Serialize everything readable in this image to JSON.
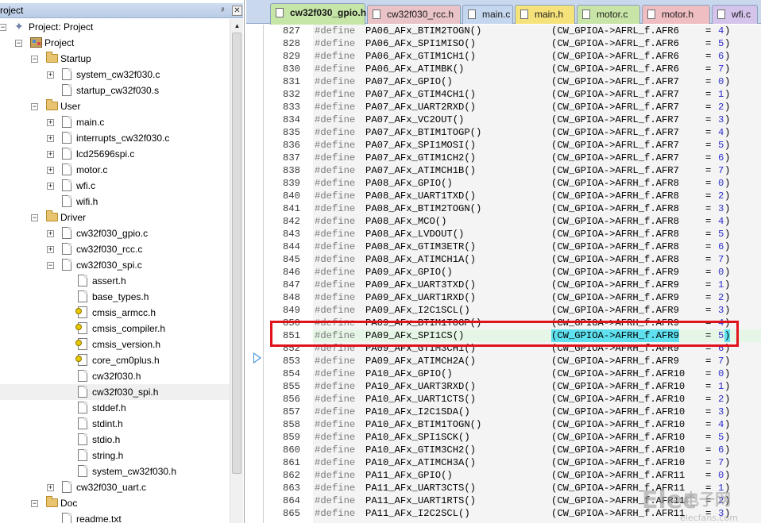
{
  "project_pane": {
    "title": "roject",
    "pin_glyph": "ᵖ",
    "close_glyph": "✕",
    "scroll_up_glyph": "▲",
    "tree": [
      {
        "label": "Project: Project",
        "depth": 0,
        "icon": "root-project-icon",
        "expander": "−"
      },
      {
        "label": "Project",
        "depth": 1,
        "icon": "target-icon",
        "expander": "−"
      },
      {
        "label": "Startup",
        "depth": 2,
        "icon": "folder-icon",
        "expander": "−"
      },
      {
        "label": "system_cw32f030.c",
        "depth": 3,
        "icon": "file-icon",
        "expander": "+"
      },
      {
        "label": "startup_cw32f030.s",
        "depth": 3,
        "icon": "file-icon",
        "expander": ""
      },
      {
        "label": "User",
        "depth": 2,
        "icon": "folder-icon",
        "expander": "−"
      },
      {
        "label": "main.c",
        "depth": 3,
        "icon": "file-icon",
        "expander": "+"
      },
      {
        "label": "interrupts_cw32f030.c",
        "depth": 3,
        "icon": "file-icon",
        "expander": "+"
      },
      {
        "label": "lcd25696spi.c",
        "depth": 3,
        "icon": "file-icon",
        "expander": "+"
      },
      {
        "label": "motor.c",
        "depth": 3,
        "icon": "file-icon",
        "expander": "+"
      },
      {
        "label": "wfi.c",
        "depth": 3,
        "icon": "file-icon",
        "expander": "+"
      },
      {
        "label": "wifi.h",
        "depth": 3,
        "icon": "file-icon",
        "expander": ""
      },
      {
        "label": "Driver",
        "depth": 2,
        "icon": "folder-icon",
        "expander": "−"
      },
      {
        "label": "cw32f030_gpio.c",
        "depth": 3,
        "icon": "file-icon",
        "expander": "+"
      },
      {
        "label": "cw32f030_rcc.c",
        "depth": 3,
        "icon": "file-icon",
        "expander": "+"
      },
      {
        "label": "cw32f030_spi.c",
        "depth": 3,
        "icon": "file-icon",
        "expander": "−"
      },
      {
        "label": "assert.h",
        "depth": 4,
        "icon": "file-icon",
        "expander": ""
      },
      {
        "label": "base_types.h",
        "depth": 4,
        "icon": "file-icon",
        "expander": ""
      },
      {
        "label": "cmsis_armcc.h",
        "depth": 4,
        "icon": "key-file-icon",
        "expander": ""
      },
      {
        "label": "cmsis_compiler.h",
        "depth": 4,
        "icon": "key-file-icon",
        "expander": ""
      },
      {
        "label": "cmsis_version.h",
        "depth": 4,
        "icon": "key-file-icon",
        "expander": ""
      },
      {
        "label": "core_cm0plus.h",
        "depth": 4,
        "icon": "key-file-icon",
        "expander": ""
      },
      {
        "label": "cw32f030.h",
        "depth": 4,
        "icon": "file-icon",
        "expander": ""
      },
      {
        "label": "cw32f030_spi.h",
        "depth": 4,
        "icon": "file-icon",
        "expander": "",
        "selected": true
      },
      {
        "label": "stddef.h",
        "depth": 4,
        "icon": "file-icon",
        "expander": ""
      },
      {
        "label": "stdint.h",
        "depth": 4,
        "icon": "file-icon",
        "expander": ""
      },
      {
        "label": "stdio.h",
        "depth": 4,
        "icon": "file-icon",
        "expander": ""
      },
      {
        "label": "string.h",
        "depth": 4,
        "icon": "file-icon",
        "expander": ""
      },
      {
        "label": "system_cw32f030.h",
        "depth": 4,
        "icon": "file-icon",
        "expander": ""
      },
      {
        "label": "cw32f030_uart.c",
        "depth": 3,
        "icon": "file-icon",
        "expander": "+"
      },
      {
        "label": "Doc",
        "depth": 2,
        "icon": "folder-icon",
        "expander": "−"
      },
      {
        "label": "readme.txt",
        "depth": 3,
        "icon": "file-icon",
        "expander": ""
      }
    ]
  },
  "tabs": [
    {
      "label": "cw32f030_gpio.h",
      "color": "#c6e6a8",
      "active": true
    },
    {
      "label": "cw32f030_rcc.h",
      "color": "#e9c3c6",
      "active": false
    },
    {
      "label": "main.c",
      "color": "#c5d7ef",
      "active": false
    },
    {
      "label": "main.h",
      "color": "#f5e27a",
      "active": false
    },
    {
      "label": "motor.c",
      "color": "#c8e4a6",
      "active": false
    },
    {
      "label": "motor.h",
      "color": "#efbec3",
      "active": false
    },
    {
      "label": "wfi.c",
      "color": "#d4c4ec",
      "active": false
    }
  ],
  "code": {
    "current_line": 851,
    "lines": [
      {
        "n": "827",
        "kw": "#define",
        "name": "PA06_AFx_BTIM2TOGN()",
        "expr": "(CW_GPIOA->AFRL_f.AFR6",
        "val": "4"
      },
      {
        "n": "828",
        "kw": "#define",
        "name": "PA06_AFx_SPI1MISO()",
        "expr": "(CW_GPIOA->AFRL_f.AFR6",
        "val": "5"
      },
      {
        "n": "829",
        "kw": "#define",
        "name": "PA06_AFx_GTIM1CH1()",
        "expr": "(CW_GPIOA->AFRL_f.AFR6",
        "val": "6"
      },
      {
        "n": "830",
        "kw": "#define",
        "name": "PA06_AFx_ATIMBK()",
        "expr": "(CW_GPIOA->AFRL_f.AFR6",
        "val": "7"
      },
      {
        "n": "831",
        "kw": "#define",
        "name": "PA07_AFx_GPIO()",
        "expr": "(CW_GPIOA->AFRL_f.AFR7",
        "val": "0"
      },
      {
        "n": "832",
        "kw": "#define",
        "name": "PA07_AFx_GTIM4CH1()",
        "expr": "(CW_GPIOA->AFRL_f.AFR7",
        "val": "1"
      },
      {
        "n": "833",
        "kw": "#define",
        "name": "PA07_AFx_UART2RXD()",
        "expr": "(CW_GPIOA->AFRL_f.AFR7",
        "val": "2"
      },
      {
        "n": "834",
        "kw": "#define",
        "name": "PA07_AFx_VC2OUT()",
        "expr": "(CW_GPIOA->AFRL_f.AFR7",
        "val": "3"
      },
      {
        "n": "835",
        "kw": "#define",
        "name": "PA07_AFx_BTIM1TOGP()",
        "expr": "(CW_GPIOA->AFRL_f.AFR7",
        "val": "4"
      },
      {
        "n": "836",
        "kw": "#define",
        "name": "PA07_AFx_SPI1MOSI()",
        "expr": "(CW_GPIOA->AFRL_f.AFR7",
        "val": "5"
      },
      {
        "n": "837",
        "kw": "#define",
        "name": "PA07_AFx_GTIM1CH2()",
        "expr": "(CW_GPIOA->AFRL_f.AFR7",
        "val": "6"
      },
      {
        "n": "838",
        "kw": "#define",
        "name": "PA07_AFx_ATIMCH1B()",
        "expr": "(CW_GPIOA->AFRL_f.AFR7",
        "val": "7"
      },
      {
        "n": "839",
        "kw": "#define",
        "name": "PA08_AFx_GPIO()",
        "expr": "(CW_GPIOA->AFRH_f.AFR8",
        "val": "0"
      },
      {
        "n": "840",
        "kw": "#define",
        "name": "PA08_AFx_UART1TXD()",
        "expr": "(CW_GPIOA->AFRH_f.AFR8",
        "val": "2"
      },
      {
        "n": "841",
        "kw": "#define",
        "name": "PA08_AFx_BTIM2TOGN()",
        "expr": "(CW_GPIOA->AFRH_f.AFR8",
        "val": "3"
      },
      {
        "n": "842",
        "kw": "#define",
        "name": "PA08_AFx_MCO()",
        "expr": "(CW_GPIOA->AFRH_f.AFR8",
        "val": "4"
      },
      {
        "n": "843",
        "kw": "#define",
        "name": "PA08_AFx_LVDOUT()",
        "expr": "(CW_GPIOA->AFRH_f.AFR8",
        "val": "5"
      },
      {
        "n": "844",
        "kw": "#define",
        "name": "PA08_AFx_GTIM3ETR()",
        "expr": "(CW_GPIOA->AFRH_f.AFR8",
        "val": "6"
      },
      {
        "n": "845",
        "kw": "#define",
        "name": "PA08_AFx_ATIMCH1A()",
        "expr": "(CW_GPIOA->AFRH_f.AFR8",
        "val": "7"
      },
      {
        "n": "846",
        "kw": "#define",
        "name": "PA09_AFx_GPIO()",
        "expr": "(CW_GPIOA->AFRH_f.AFR9",
        "val": "0"
      },
      {
        "n": "847",
        "kw": "#define",
        "name": "PA09_AFx_UART3TXD()",
        "expr": "(CW_GPIOA->AFRH_f.AFR9",
        "val": "1"
      },
      {
        "n": "848",
        "kw": "#define",
        "name": "PA09_AFx_UART1RXD()",
        "expr": "(CW_GPIOA->AFRH_f.AFR9",
        "val": "2"
      },
      {
        "n": "849",
        "kw": "#define",
        "name": "PA09_AFx_I2C1SCL()",
        "expr": "(CW_GPIOA->AFRH_f.AFR9",
        "val": "3"
      },
      {
        "n": "850",
        "kw": "#define",
        "name": "PA09_AFx_BTIM1TOGP()",
        "expr": "(CW_GPIOA->AFRH_f.AFR9",
        "val": "4"
      },
      {
        "n": "851",
        "kw": "#define",
        "name": "PA09_AFx_SPI1CS()",
        "expr": "(CW_GPIOA->AFRH_f.AFR9",
        "val": "5"
      },
      {
        "n": "852",
        "kw": "#define",
        "name": "PA09_AFx_GTIM3CH1()",
        "expr": "(CW_GPIOA->AFRH_f.AFR9",
        "val": "6"
      },
      {
        "n": "853",
        "kw": "#define",
        "name": "PA09_AFx_ATIMCH2A()",
        "expr": "(CW_GPIOA->AFRH_f.AFR9",
        "val": "7"
      },
      {
        "n": "854",
        "kw": "#define",
        "name": "PA10_AFx_GPIO()",
        "expr": "(CW_GPIOA->AFRH_f.AFR10",
        "val": "0"
      },
      {
        "n": "855",
        "kw": "#define",
        "name": "PA10_AFx_UART3RXD()",
        "expr": "(CW_GPIOA->AFRH_f.AFR10",
        "val": "1"
      },
      {
        "n": "856",
        "kw": "#define",
        "name": "PA10_AFx_UART1CTS()",
        "expr": "(CW_GPIOA->AFRH_f.AFR10",
        "val": "2"
      },
      {
        "n": "857",
        "kw": "#define",
        "name": "PA10_AFx_I2C1SDA()",
        "expr": "(CW_GPIOA->AFRH_f.AFR10",
        "val": "3"
      },
      {
        "n": "858",
        "kw": "#define",
        "name": "PA10_AFx_BTIM1TOGN()",
        "expr": "(CW_GPIOA->AFRH_f.AFR10",
        "val": "4"
      },
      {
        "n": "859",
        "kw": "#define",
        "name": "PA10_AFx_SPI1SCK()",
        "expr": "(CW_GPIOA->AFRH_f.AFR10",
        "val": "5"
      },
      {
        "n": "860",
        "kw": "#define",
        "name": "PA10_AFx_GTIM3CH2()",
        "expr": "(CW_GPIOA->AFRH_f.AFR10",
        "val": "6"
      },
      {
        "n": "861",
        "kw": "#define",
        "name": "PA10_AFx_ATIMCH3A()",
        "expr": "(CW_GPIOA->AFRH_f.AFR10",
        "val": "7"
      },
      {
        "n": "862",
        "kw": "#define",
        "name": "PA11_AFx_GPIO()",
        "expr": "(CW_GPIOA->AFRH_f.AFR11",
        "val": "0"
      },
      {
        "n": "863",
        "kw": "#define",
        "name": "PA11_AFx_UART3CTS()",
        "expr": "(CW_GPIOA->AFRH_f.AFR11",
        "val": "1"
      },
      {
        "n": "864",
        "kw": "#define",
        "name": "PA11_AFx_UART1RTS()",
        "expr": "(CW_GPIOA->AFRH_f.AFR11",
        "val": "2"
      },
      {
        "n": "865",
        "kw": "#define",
        "name": "PA11_AFx_I2C2SCL()",
        "expr": "(CW_GPIOA->AFRH_f.AFR11",
        "val": "3"
      }
    ]
  },
  "watermark": {
    "logo": "Elec",
    "text": "电子网",
    "site": "elecfans.com"
  },
  "colors": {
    "highlight_box": "#e0121b",
    "bracket_highlight": "#5ee0ee",
    "current_line_bg": "#e6f6e6"
  }
}
